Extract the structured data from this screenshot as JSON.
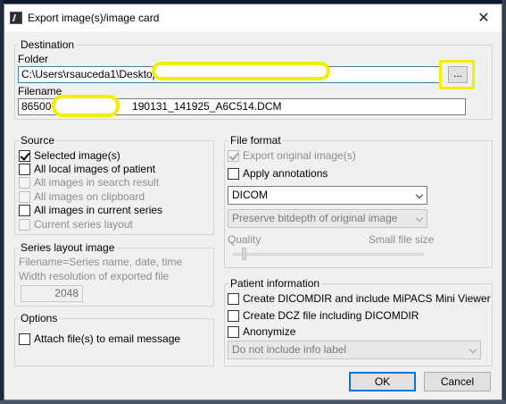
{
  "window": {
    "title": "Export image(s)/image card",
    "close_glyph": "✕"
  },
  "destination": {
    "group_title": "Destination",
    "folder_label": "Folder",
    "folder_value": "C:\\Users\\rsauceda1\\Desktop\\",
    "browse_label": "...",
    "filename_label": "Filename",
    "filename_prefix": "865007",
    "filename_suffix": "190131_141925_A6C514.DCM"
  },
  "source": {
    "group_title": "Source",
    "items": [
      {
        "label": "Selected image(s)",
        "checked": true,
        "enabled": true
      },
      {
        "label": "All local images of patient",
        "checked": false,
        "enabled": true
      },
      {
        "label": "All images in search result",
        "checked": false,
        "enabled": false
      },
      {
        "label": "All images on clipboard",
        "checked": false,
        "enabled": false
      },
      {
        "label": "All images in current series",
        "checked": false,
        "enabled": true
      },
      {
        "label": "Current series layout",
        "checked": false,
        "enabled": false
      }
    ]
  },
  "series_layout": {
    "group_title": "Series layout image",
    "filename_note": "Filename=Series name, date, time",
    "width_label": "Width resolution of exported file",
    "width_value": "2048"
  },
  "options": {
    "group_title": "Options",
    "email_label": "Attach file(s) to email message"
  },
  "file_format": {
    "group_title": "File format",
    "export_original_label": "Export original image(s)",
    "apply_annotations_label": "Apply annotations",
    "format_selected": "DICOM",
    "bitdepth_selected": "Preserve bitdepth of original image",
    "quality_label": "Quality",
    "small_file_label": "Small file size",
    "quality_level": 0.05
  },
  "patient_info": {
    "group_title": "Patient information",
    "dicomdir_label": "Create DICOMDIR and include MiPACS Mini Viewer",
    "dcz_label": "Create DCZ file including DICOMDIR",
    "anonymize_label": "Anonymize",
    "info_label_selected": "Do not include info label"
  },
  "buttons": {
    "ok": "OK",
    "cancel": "Cancel"
  },
  "colors": {
    "accent": "#0078d7",
    "highlight": "#f4ee00",
    "background": "#f0f0f0"
  }
}
